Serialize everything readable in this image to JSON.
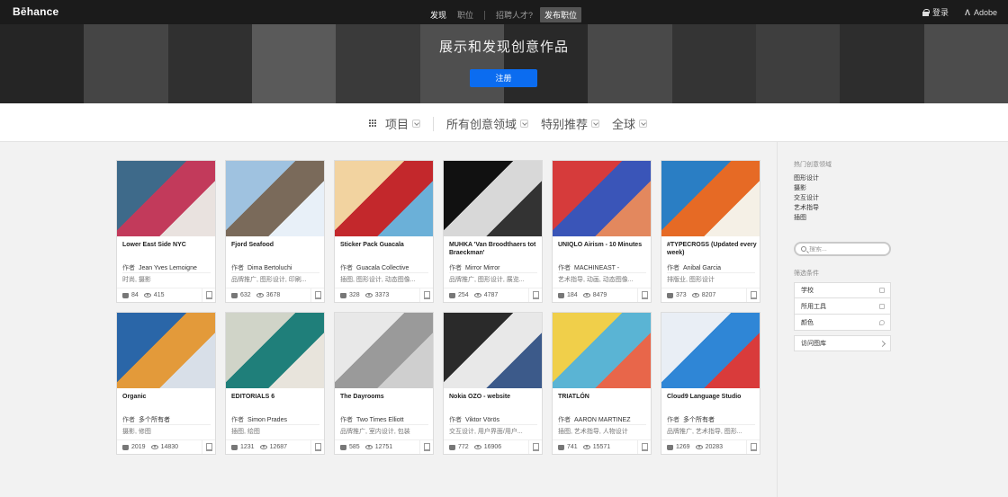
{
  "app": {
    "logo": "Bēhance"
  },
  "topnav": {
    "items": [
      {
        "label": "发现",
        "active": true
      },
      {
        "label": "职位",
        "active": false
      }
    ],
    "hire_text": "招聘人才?",
    "post_job": "发布职位",
    "login": "登录",
    "adobe": "Adobe",
    "adobe_icon": "Λ"
  },
  "hero": {
    "title": "展示和发现创意作品",
    "signup": "注册",
    "tile_colors": [
      "#3a3a3a",
      "#6a6a6a",
      "#4a4a4a",
      "#8a8a8a",
      "#5a5a5a",
      "#7a7a7a",
      "#404040",
      "#707070",
      "#505050",
      "#606060",
      "#454545",
      "#757575"
    ]
  },
  "filters": [
    {
      "label": "项目"
    },
    {
      "label": "所有创意领域"
    },
    {
      "label": "特别推荐"
    },
    {
      "label": "全球"
    }
  ],
  "owner_prefix": "作者",
  "projects": [
    {
      "title": "Lower East Side NYC",
      "owner": "Jean Yves Lemoigne",
      "fields": "时尚, 摄影",
      "likes": "84",
      "views": "415",
      "colors": [
        "#3e6a8a",
        "#c23a5b",
        "#e9e2df"
      ]
    },
    {
      "title": "Fjord Seafood",
      "owner": "Dima Bertoluchi",
      "fields": "品牌推广, 图形设计, 印刷...",
      "likes": "632",
      "views": "3678",
      "colors": [
        "#9fc2e0",
        "#7a6a5a",
        "#e8f0f8"
      ]
    },
    {
      "title": "Sticker Pack Guacala",
      "owner": "Guacala Collective",
      "fields": "插图, 图形设计, 动态图像...",
      "likes": "328",
      "views": "3373",
      "colors": [
        "#f2d3a0",
        "#c3282c",
        "#6bb0d8"
      ]
    },
    {
      "title": "MUHKA 'Van Broodthaers tot Braeckman'",
      "owner": "Mirror Mirror",
      "fields": "品牌推广, 图形设计, 展览...",
      "likes": "254",
      "views": "4787",
      "colors": [
        "#111111",
        "#d8d8d8",
        "#333333"
      ]
    },
    {
      "title": "UNIQLO Airism - 10 Minutes",
      "owner": "MACHINEAST -",
      "fields": "艺术指导, 动画, 动态图像...",
      "likes": "184",
      "views": "8479",
      "colors": [
        "#d63b3b",
        "#3a55b8",
        "#e3885e"
      ]
    },
    {
      "title": "#TYPECROSS (Updated every week)",
      "owner": "Anibal Garcia",
      "fields": "排版业, 图形设计",
      "likes": "373",
      "views": "8207",
      "colors": [
        "#2a7ec4",
        "#e66a25",
        "#f5f0e6"
      ]
    },
    {
      "title": "Organic",
      "owner": "多个所有者",
      "fields": "摄影, 修图",
      "likes": "2019",
      "views": "14830",
      "colors": [
        "#2a66a8",
        "#e39a3a",
        "#d8dfe8"
      ]
    },
    {
      "title": "EDITORIALS 6",
      "owner": "Simon Prades",
      "fields": "插图, 绘图",
      "likes": "1231",
      "views": "12687",
      "colors": [
        "#d0d4c8",
        "#1f7f7a",
        "#e8e4dc"
      ]
    },
    {
      "title": "The Dayrooms",
      "owner": "Two Times Elliott",
      "fields": "品牌推广, 室内设计, 包装",
      "likes": "585",
      "views": "12751",
      "colors": [
        "#e8e8e8",
        "#9a9a9a",
        "#cfcfcf"
      ]
    },
    {
      "title": "Nokia OZO - website",
      "owner": "Viktor Vörös",
      "fields": "交互设计, 用户界面/用户...",
      "likes": "772",
      "views": "16906",
      "colors": [
        "#2a2a2a",
        "#e8e8e8",
        "#3c5a8a"
      ]
    },
    {
      "title": "TRIATLÓN",
      "owner": "AARON MARTINEZ",
      "fields": "插图, 艺术指导, 人物设计",
      "likes": "741",
      "views": "15571",
      "colors": [
        "#f0cf4a",
        "#5ab4d4",
        "#e8664a"
      ]
    },
    {
      "title": "Cloud9 Language Studio",
      "owner": "多个所有者",
      "fields": "品牌推广, 艺术指导, 图形...",
      "likes": "1269",
      "views": "20283",
      "colors": [
        "#e9eef5",
        "#2f86d6",
        "#d93b3b"
      ]
    }
  ],
  "sidebar": {
    "popular_title": "热门创意领域",
    "popular": [
      "图形设计",
      "摄影",
      "交互设计",
      "艺术指导",
      "插图"
    ],
    "search_placeholder": "搜索...",
    "filter_title": "筛选条件",
    "filter_boxes": [
      {
        "label": "学校",
        "icon": "school-icon"
      },
      {
        "label": "所用工具",
        "icon": "tools-icon"
      },
      {
        "label": "颜色",
        "icon": "color-icon"
      }
    ],
    "gallery": "访问图库"
  }
}
